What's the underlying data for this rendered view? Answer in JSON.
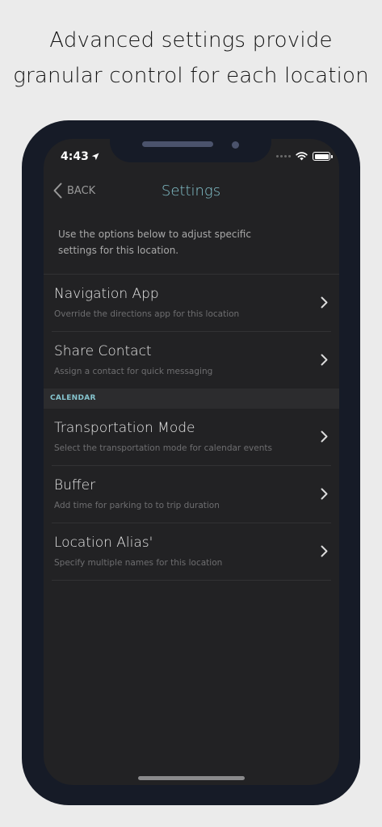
{
  "headline": {
    "line1": "Advanced settings provide",
    "line2": "granular control for each location"
  },
  "status_bar": {
    "time": "4:43"
  },
  "nav": {
    "back_label": "BACK",
    "title": "Settings"
  },
  "intro_text": "Use the options below to adjust specific settings for this location.",
  "rows": [
    {
      "title": "Navigation App",
      "subtitle": "Override the directions app for this location"
    },
    {
      "title": "Share Contact",
      "subtitle": "Assign a contact for quick messaging"
    }
  ],
  "calendar_section": {
    "header": "CALENDAR",
    "rows": [
      {
        "title": "Transportation Mode",
        "subtitle": "Select the transportation mode for calendar events"
      },
      {
        "title": "Buffer",
        "subtitle": "Add time for parking to to trip duration"
      },
      {
        "title": "Location Alias'",
        "subtitle": "Specify multiple names for this location"
      }
    ]
  },
  "colors": {
    "accent": "#86c5cf",
    "screen_background": "#222224",
    "phone_frame": "#161b27",
    "page_background": "#ebebeb"
  },
  "icons": {
    "location_arrow": "location-arrow-icon",
    "back": "chevron-left-icon",
    "disclosure": "chevron-right-icon",
    "wifi": "wifi-icon",
    "battery": "battery-icon"
  }
}
